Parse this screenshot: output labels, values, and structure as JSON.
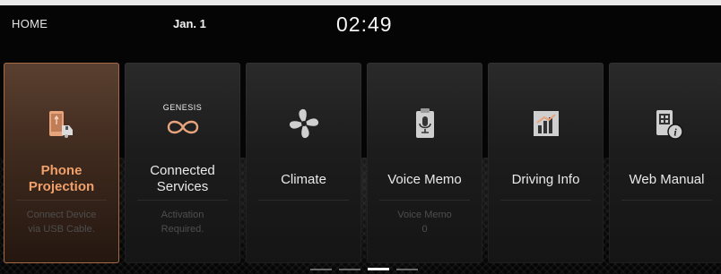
{
  "status": {
    "home_label": "HOME",
    "date": "Jan. 1",
    "time": "02:49"
  },
  "tiles": [
    {
      "label_line1": "Phone",
      "label_line2": "Projection",
      "sub_line1": "Connect Device",
      "sub_line2": "via USB Cable.",
      "icon": "phone-projection-icon",
      "active": true
    },
    {
      "label_line1": "Connected",
      "label_line2": "Services",
      "sub_line1": "Activation",
      "sub_line2": "Required.",
      "icon": "genesis-infinity-icon",
      "brand": "GENESIS"
    },
    {
      "label": "Climate",
      "icon": "fan-icon"
    },
    {
      "label": "Voice Memo",
      "sub_line1": "Voice Memo",
      "sub_line2": "0",
      "icon": "voice-memo-icon"
    },
    {
      "label": "Driving Info",
      "icon": "driving-info-icon"
    },
    {
      "label": "Web Manual",
      "icon": "web-manual-icon"
    }
  ],
  "page_indicator": {
    "count": 4,
    "active_index": 2
  },
  "colors": {
    "accent": "#f0a06a",
    "active_border": "#a66a45"
  }
}
